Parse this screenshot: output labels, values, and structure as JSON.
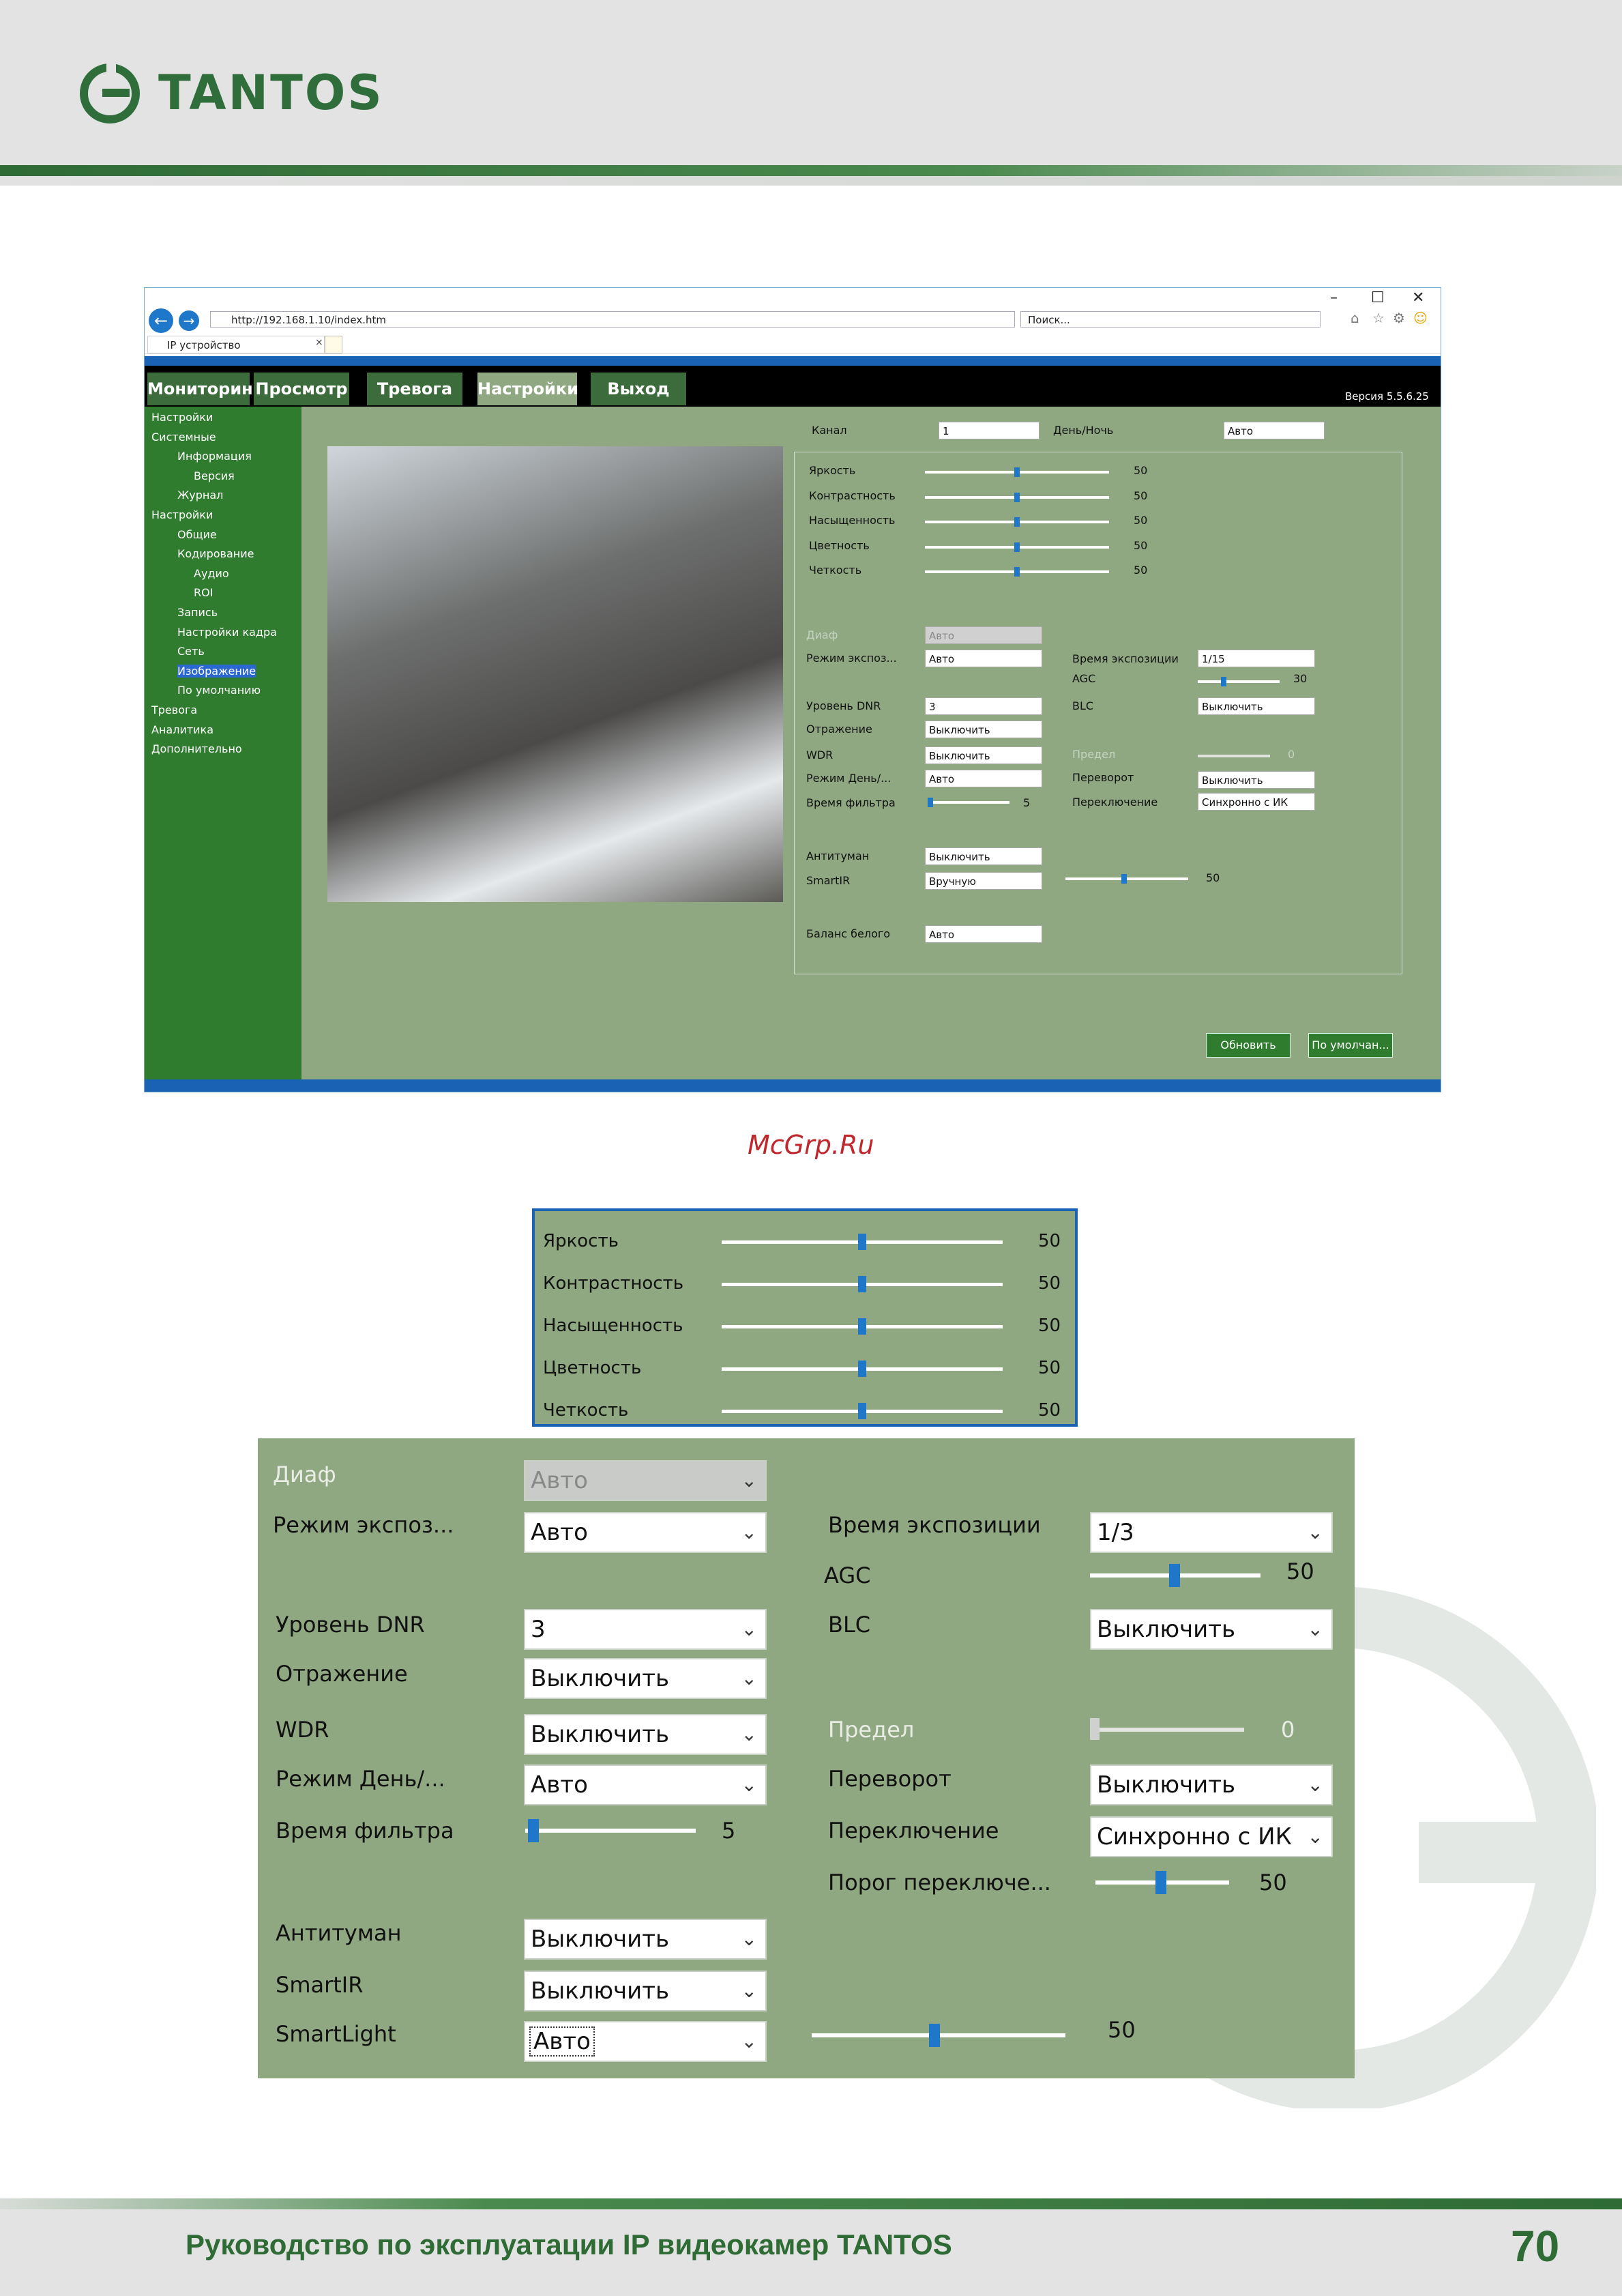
{
  "header": {
    "logo_text": "TANTOS"
  },
  "browser": {
    "url": "http://192.168.1.10/index.htm",
    "search_placeholder": "Поиск...",
    "tab_title": "IP устройство",
    "nav_tabs": [
      "Мониторинг",
      "Просмотр",
      "Тревога",
      "Настройки",
      "Выход"
    ],
    "active_tab": "Настройки",
    "version": "Версия 5.5.6.25",
    "sidebar": [
      {
        "label": "Настройки",
        "level": 0
      },
      {
        "label": "Системные",
        "level": 0
      },
      {
        "label": "Информация",
        "level": 1
      },
      {
        "label": "Версия",
        "level": 2
      },
      {
        "label": "Журнал",
        "level": 1
      },
      {
        "label": "Настройки",
        "level": 0
      },
      {
        "label": "Общие",
        "level": 1
      },
      {
        "label": "Кодирование",
        "level": 1
      },
      {
        "label": "Аудио",
        "level": 2
      },
      {
        "label": "ROI",
        "level": 2
      },
      {
        "label": "Запись",
        "level": 1
      },
      {
        "label": "Настройки кадра",
        "level": 1
      },
      {
        "label": "Сеть",
        "level": 1
      },
      {
        "label": "Изображение",
        "level": 1,
        "selected": true
      },
      {
        "label": "По умолчанию",
        "level": 1
      },
      {
        "label": "Тревога",
        "level": 0
      },
      {
        "label": "Аналитика",
        "level": 0
      },
      {
        "label": "Дополнительно",
        "level": 0
      }
    ],
    "channel_label": "Канал",
    "channel_value": "1",
    "daynight_label": "День/Ночь",
    "daynight_value": "Авто",
    "sliders": [
      {
        "label": "Яркость",
        "value": "50"
      },
      {
        "label": "Контрастность",
        "value": "50"
      },
      {
        "label": "Насыщенность",
        "value": "50"
      },
      {
        "label": "Цветность",
        "value": "50"
      },
      {
        "label": "Четкость",
        "value": "50"
      }
    ],
    "left_rows": [
      {
        "label": "Диаф",
        "value": "Авто",
        "disabled": true
      },
      {
        "label": "Режим экспоз...",
        "value": "Авто"
      },
      {
        "label": "Уровень DNR",
        "value": "3"
      },
      {
        "label": "Отражение",
        "value": "Выключить"
      },
      {
        "label": "WDR",
        "value": "Выключить"
      },
      {
        "label": "Режим День/...",
        "value": "Авто"
      },
      {
        "label": "Время фильтра",
        "slider_value": "5"
      },
      {
        "label": "Антитуман",
        "value": "Выключить"
      },
      {
        "label": "SmartIR",
        "value": "Вручную"
      },
      {
        "label": "Баланс белого",
        "value": "Авто"
      }
    ],
    "right_rows": {
      "exposure_time_label": "Время экспозиции",
      "exposure_time_value": "1/15",
      "agc_label": "AGC",
      "agc_value": "30",
      "blc_label": "BLC",
      "blc_value": "Выключить",
      "limit_label": "Предел",
      "limit_value": "0",
      "flip_label": "Переворот",
      "flip_value": "Выключить",
      "switch_label": "Переключение",
      "switch_value": "Синхронно с ИК",
      "smartir_slider_value": "50"
    },
    "buttons": {
      "refresh": "Обновить",
      "default": "По умолчан..."
    }
  },
  "watermark_site": "McGrp.Ru",
  "zoom1": [
    {
      "label": "Яркость",
      "value": "50"
    },
    {
      "label": "Контрастность",
      "value": "50"
    },
    {
      "label": "Насыщенность",
      "value": "50"
    },
    {
      "label": "Цветность",
      "value": "50"
    },
    {
      "label": "Четкость",
      "value": "50"
    }
  ],
  "zoom2": {
    "iris_label": "Диаф",
    "iris_value": "Авто",
    "exp_mode_label": "Режим экспоз...",
    "exp_mode_value": "Авто",
    "exp_time_label": "Время экспозиции",
    "exp_time_value": "1/3",
    "agc_label": "AGC",
    "agc_value": "50",
    "dnr_label": "Уровень DNR",
    "dnr_value": "3",
    "blc_label": "BLC",
    "blc_value": "Выключить",
    "mirror_label": "Отражение",
    "mirror_value": "Выключить",
    "wdr_label": "WDR",
    "wdr_value": "Выключить",
    "limit_label": "Предел",
    "limit_value": "0",
    "daynight_label": "Режим День/...",
    "daynight_value": "Авто",
    "flip_label": "Переворот",
    "flip_value": "Выключить",
    "filter_label": "Время фильтра",
    "filter_value": "5",
    "switch_label": "Переключение",
    "switch_value": "Синхронно с ИК",
    "threshold_label": "Порог переключе...",
    "threshold_value": "50",
    "defog_label": "Антитуман",
    "defog_value": "Выключить",
    "smartir_label": "SmartIR",
    "smartir_value": "Выключить",
    "smartlight_label": "SmartLight",
    "smartlight_value": "Авто",
    "smartlight_slider_value": "50"
  },
  "footer": {
    "title": "Руководство по эксплуатации IP видеокамер TANTOS",
    "page": "70"
  }
}
